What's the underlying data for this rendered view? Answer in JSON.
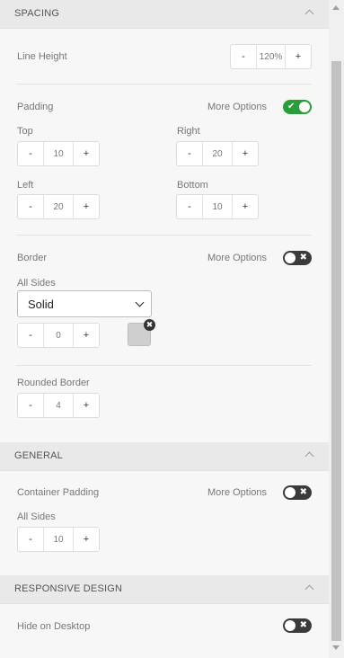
{
  "spacing": {
    "title": "SPACING",
    "line_height": {
      "label": "Line Height",
      "minus": "-",
      "value": "120%",
      "plus": "+"
    },
    "padding": {
      "label": "Padding",
      "more_options": "More Options",
      "toggle_on": true,
      "top": {
        "label": "Top",
        "value": "10"
      },
      "right": {
        "label": "Right",
        "value": "20"
      },
      "left": {
        "label": "Left",
        "value": "20"
      },
      "bottom": {
        "label": "Bottom",
        "value": "10"
      }
    },
    "border": {
      "label": "Border",
      "more_options": "More Options",
      "toggle_on": false,
      "all_sides_label": "All Sides",
      "style_value": "Solid",
      "width_value": "0",
      "color": "#cfcfcf"
    },
    "rounded_border": {
      "label": "Rounded Border",
      "value": "4"
    }
  },
  "general": {
    "title": "GENERAL",
    "container_padding": {
      "label": "Container Padding",
      "more_options": "More Options",
      "toggle_on": false
    },
    "all_sides_label": "All Sides",
    "all_sides_value": "10"
  },
  "responsive": {
    "title": "RESPONSIVE DESIGN",
    "hide_on_desktop": {
      "label": "Hide on Desktop",
      "toggle_on": false
    }
  },
  "stepper": {
    "minus": "-",
    "plus": "+"
  },
  "glyphs": {
    "check": "✔",
    "cross": "✖"
  },
  "colors": {
    "toggle_on": "#2a9d3a",
    "toggle_off": "#3a3a3a",
    "header_bg": "#e9e9e9"
  }
}
